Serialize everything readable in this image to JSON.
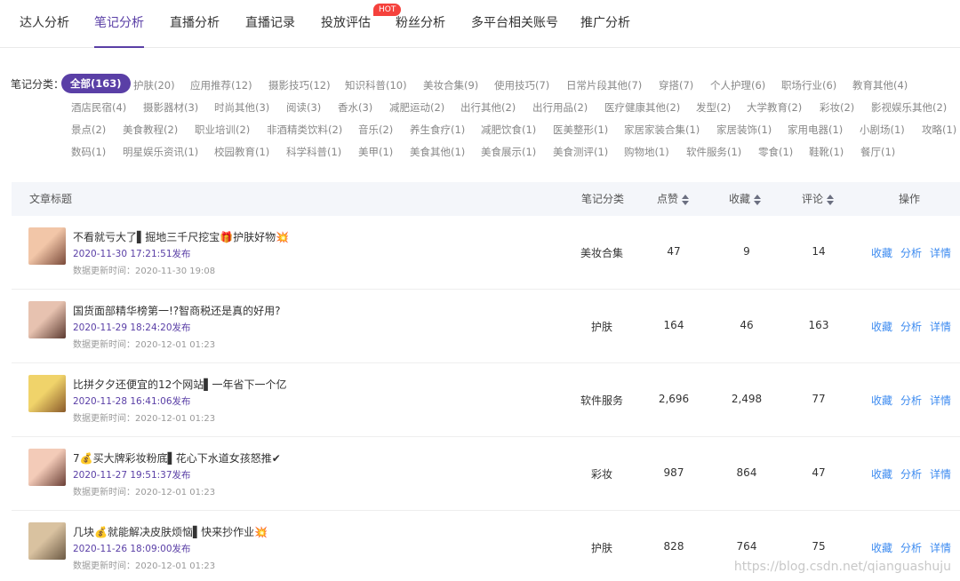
{
  "tabs": [
    {
      "label": "达人分析",
      "active": false
    },
    {
      "label": "笔记分析",
      "active": true
    },
    {
      "label": "直播分析",
      "active": false
    },
    {
      "label": "直播记录",
      "active": false
    },
    {
      "label": "投放评估",
      "active": false
    },
    {
      "label": "粉丝分析",
      "active": false
    },
    {
      "label": "多平台相关账号",
      "active": false
    },
    {
      "label": "推广分析",
      "active": false
    }
  ],
  "hot_badge": "HOT",
  "category_label": "笔记分类：",
  "categories": [
    "全部(163)",
    "护肤(20)",
    "应用推荐(12)",
    "摄影技巧(12)",
    "知识科普(10)",
    "美妆合集(9)",
    "使用技巧(7)",
    "日常片段其他(7)",
    "穿搭(7)",
    "个人护理(6)",
    "职场行业(6)",
    "教育其他(4)",
    "酒店民宿(4)",
    "摄影器材(3)",
    "时尚其他(3)",
    "阅读(3)",
    "香水(3)",
    "减肥运动(2)",
    "出行其他(2)",
    "出行用品(2)",
    "医疗健康其他(2)",
    "发型(2)",
    "大学教育(2)",
    "彩妆(2)",
    "影视娱乐其他(2)",
    "景点(2)",
    "美食教程(2)",
    "职业培训(2)",
    "非酒精类饮料(2)",
    "音乐(2)",
    "养生食疗(1)",
    "减肥饮食(1)",
    "医美整形(1)",
    "家居家装合集(1)",
    "家居装饰(1)",
    "家用电器(1)",
    "小剧场(1)",
    "攻略(1)",
    "数码(1)",
    "明星娱乐资讯(1)",
    "校园教育(1)",
    "科学科普(1)",
    "美甲(1)",
    "美食其他(1)",
    "美食展示(1)",
    "美食测评(1)",
    "购物地(1)",
    "软件服务(1)",
    "零食(1)",
    "鞋靴(1)",
    "餐厅(1)"
  ],
  "table": {
    "headers": {
      "title": "文章标题",
      "category": "笔记分类",
      "likes": "点赞",
      "collects": "收藏",
      "comments": "评论",
      "actions": "操作"
    },
    "action_labels": [
      "收藏",
      "分析",
      "详情"
    ],
    "rows": [
      {
        "title": "不看就亏大了▌掘地三千尺挖宝🎁护肤好物💥",
        "published": "2020-11-30 17:21:51发布",
        "updated": "数据更新时间：2020-11-30 19:08",
        "category": "美妆合集",
        "likes": "47",
        "collects": "9",
        "comments": "14"
      },
      {
        "title": "国货面部精华榜第一!?智商税还是真的好用?",
        "published": "2020-11-29 18:24:20发布",
        "updated": "数据更新时间：2020-12-01 01:23",
        "category": "护肤",
        "likes": "164",
        "collects": "46",
        "comments": "163"
      },
      {
        "title": "比拼夕夕还便宜的12个网站▌一年省下一个亿",
        "published": "2020-11-28 16:41:06发布",
        "updated": "数据更新时间：2020-12-01 01:23",
        "category": "软件服务",
        "likes": "2,696",
        "collects": "2,498",
        "comments": "77"
      },
      {
        "title": "7💰买大牌彩妆粉底▌花心下水道女孩怒推✔",
        "published": "2020-11-27 19:51:37发布",
        "updated": "数据更新时间：2020-12-01 01:23",
        "category": "彩妆",
        "likes": "987",
        "collects": "864",
        "comments": "47"
      },
      {
        "title": "几块💰就能解决皮肤烦恼▌快来抄作业💥",
        "published": "2020-11-26 18:09:00发布",
        "updated": "数据更新时间：2020-12-01 01:23",
        "category": "护肤",
        "likes": "828",
        "collects": "764",
        "comments": "75"
      }
    ]
  },
  "watermark": "https://blog.csdn.net/qianguashuju",
  "colors": {
    "accent": "#5a3fa6",
    "link": "#3d8bf0",
    "hot": "#f5413c",
    "header_bg": "#f4f6fa"
  }
}
